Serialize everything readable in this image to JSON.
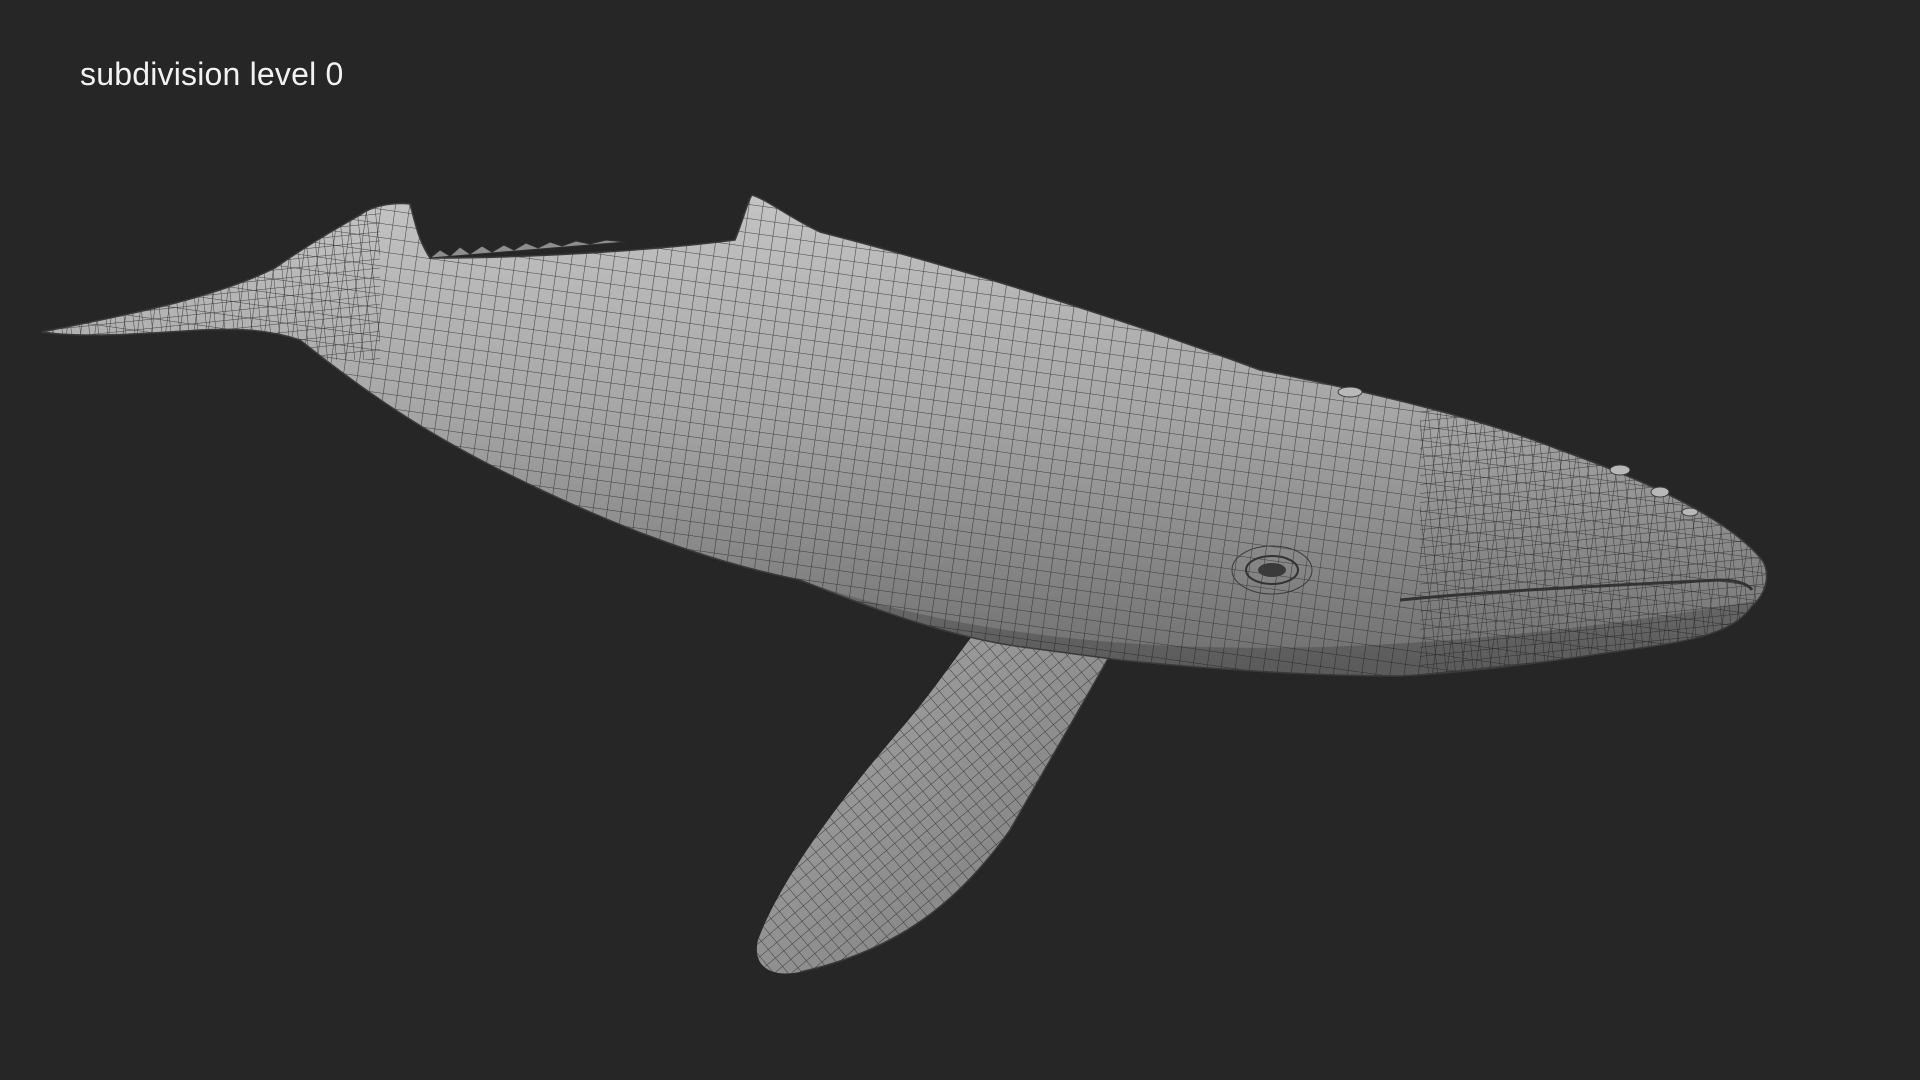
{
  "caption": "subdivision level 0",
  "scene": {
    "subject": "humpback-whale-wireframe-render",
    "background_color": "#262626",
    "mesh_fill_color": "#9c9c9c",
    "wire_color": "#2e2e2e"
  }
}
